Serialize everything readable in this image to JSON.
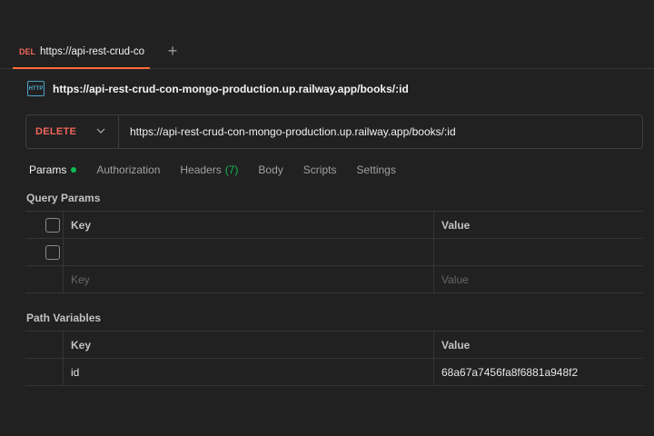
{
  "tab": {
    "method": "DEL",
    "title": "https://api-rest-crud-co",
    "new_tab": "+"
  },
  "request": {
    "icon": "http-icon",
    "icon_text": "HTTP",
    "name": "https://api-rest-crud-con-mongo-production.up.railway.app/books/:id"
  },
  "urlbar": {
    "method": "DELETE",
    "url": "https://api-rest-crud-con-mongo-production.up.railway.app/books/:id"
  },
  "subtabs": [
    {
      "label": "Params"
    },
    {
      "label": "Authorization"
    },
    {
      "label": "Headers",
      "count": "(7)"
    },
    {
      "label": "Body"
    },
    {
      "label": "Scripts"
    },
    {
      "label": "Settings"
    }
  ],
  "query_params": {
    "title": "Query Params",
    "header": {
      "key": "Key",
      "value": "Value"
    },
    "placeholder": {
      "key": "Key",
      "value": "Value"
    }
  },
  "path_variables": {
    "title": "Path Variables",
    "header": {
      "key": "Key",
      "value": "Value"
    },
    "rows": [
      {
        "key": "id",
        "value": "68a67a7456fa8f6881a948f2"
      }
    ]
  },
  "colors": {
    "accent": "#ff6c37",
    "delete_method": "#f0665a",
    "success": "#0cbb52",
    "background": "#212121"
  }
}
